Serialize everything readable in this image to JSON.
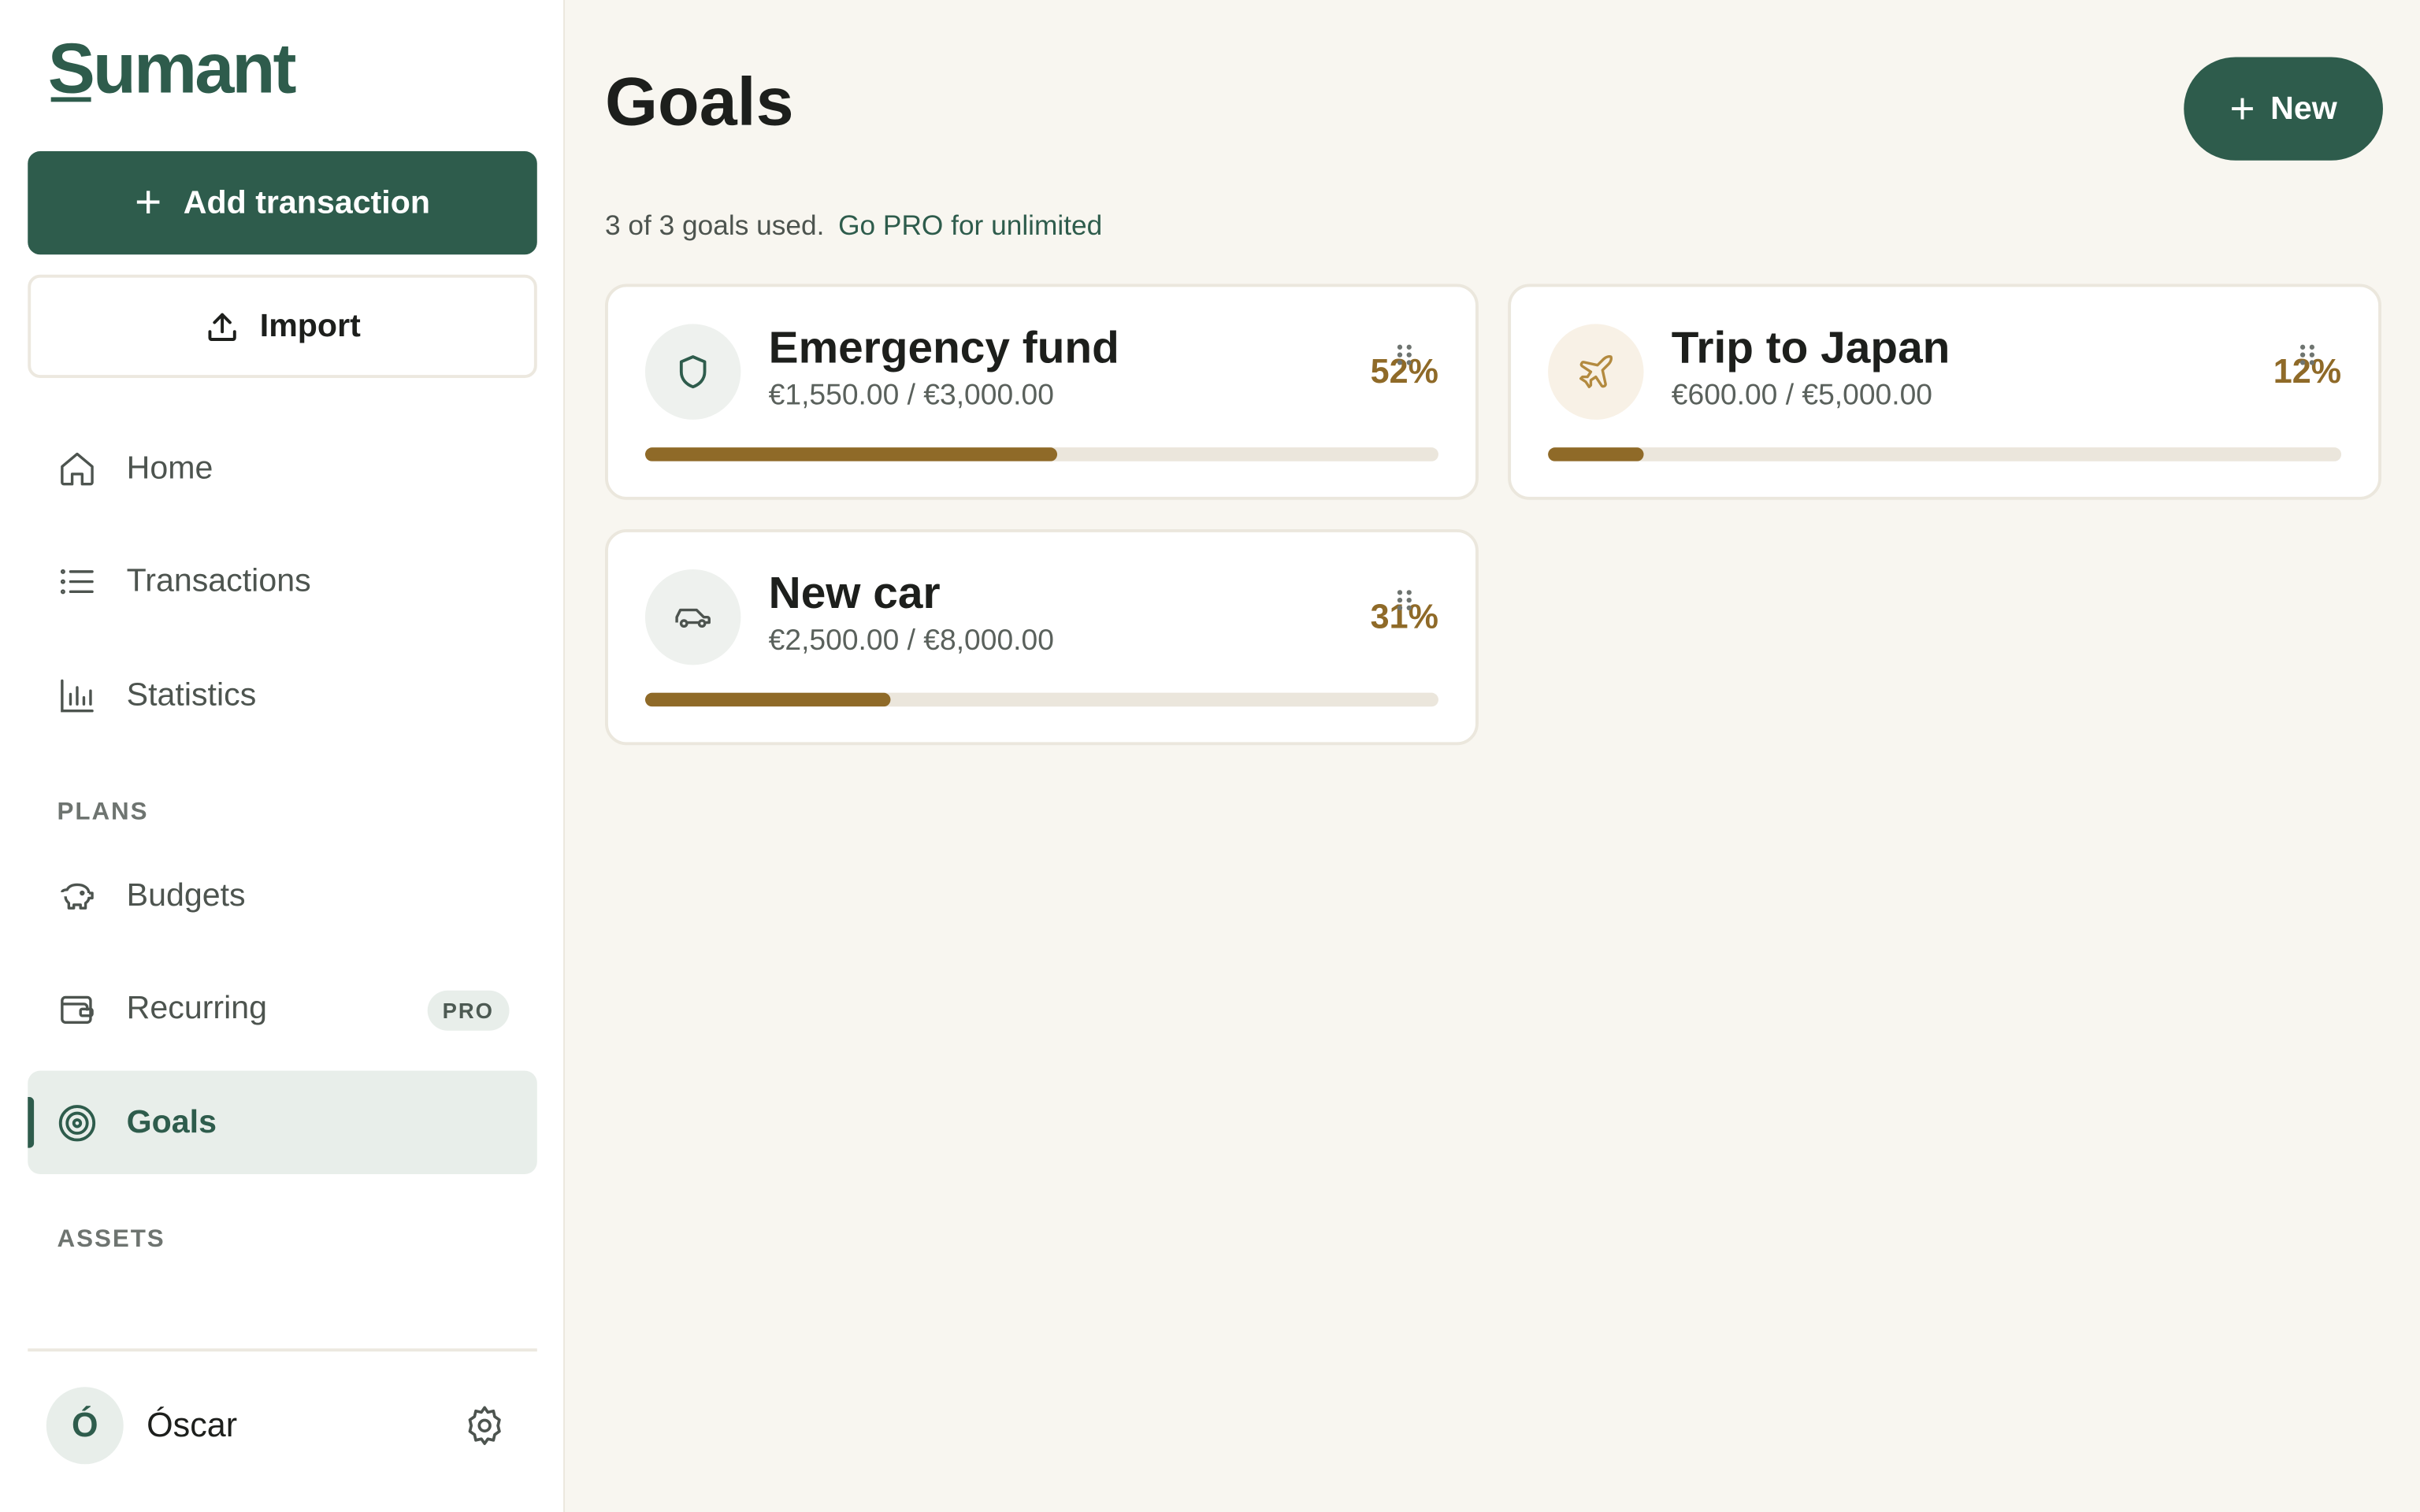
{
  "app": {
    "logo": "Sumant"
  },
  "sidebar": {
    "add_transaction": "Add transaction",
    "import": "Import",
    "nav": [
      {
        "label": "Home",
        "icon": "home-icon"
      },
      {
        "label": "Transactions",
        "icon": "list-icon"
      },
      {
        "label": "Statistics",
        "icon": "bar-chart-icon"
      }
    ],
    "plans_label": "PLANS",
    "plans": [
      {
        "label": "Budgets",
        "icon": "piggy-bank-icon"
      },
      {
        "label": "Recurring",
        "icon": "wallet-icon",
        "badge": "PRO"
      },
      {
        "label": "Goals",
        "icon": "target-icon",
        "active": true
      }
    ],
    "assets_label": "ASSETS",
    "user": {
      "initial": "Ó",
      "name": "Óscar"
    }
  },
  "main": {
    "title": "Goals",
    "new_button": "New",
    "usage_text": "3 of 3 goals used.",
    "usage_link": "Go PRO for unlimited",
    "goals": [
      {
        "title": "Emergency fund",
        "amount": "€1,550.00 / €3,000.00",
        "percent": "52%",
        "progress": 0.52,
        "icon": "shield-icon"
      },
      {
        "title": "Trip to Japan",
        "amount": "€600.00 / €5,000.00",
        "percent": "12%",
        "progress": 0.12,
        "icon": "airplane-icon"
      },
      {
        "title": "New car",
        "amount": "€2,500.00 / €8,000.00",
        "percent": "31%",
        "progress": 0.31,
        "icon": "car-icon"
      }
    ]
  },
  "colors": {
    "brand": "#2e5c4c",
    "progress": "#8f6a28",
    "background": "#f8f6f0"
  }
}
